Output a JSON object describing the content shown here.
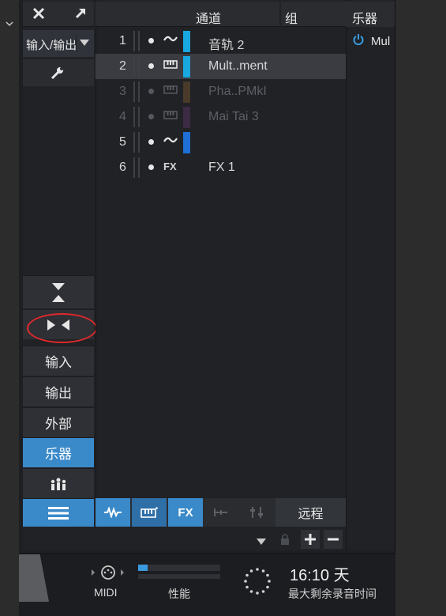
{
  "outer": {
    "chevron_icon": "chevron-down-icon"
  },
  "left_panel": {
    "io_dropdown": "输入/输出",
    "buttons": [
      "输入",
      "输出",
      "外部",
      "乐器"
    ],
    "active_button": "乐器"
  },
  "header": {
    "channel": "通道",
    "group": "组",
    "instrument": "乐器"
  },
  "tracks": [
    {
      "num": "1",
      "type": "audio",
      "color": "#18a7de",
      "name": "音轨 2",
      "selected": false,
      "dim": false
    },
    {
      "num": "2",
      "type": "instrument",
      "color": "#18a7de",
      "name": "Mult..ment",
      "selected": true,
      "dim": false
    },
    {
      "num": "3",
      "type": "instrument",
      "color": "#4a3a2a",
      "name": "Pha..PMkI",
      "selected": false,
      "dim": true
    },
    {
      "num": "4",
      "type": "instrument",
      "color": "#3d2a45",
      "name": "Mai Tai 3",
      "selected": false,
      "dim": true
    },
    {
      "num": "5",
      "type": "audio",
      "color": "#1e6fd6",
      "name": "",
      "selected": false,
      "dim": false
    },
    {
      "num": "6",
      "type": "fx",
      "type_label": "FX",
      "color": "",
      "name": "FX 1",
      "selected": false,
      "dim": false
    }
  ],
  "instrument_panel": {
    "item": "Mul",
    "power_icon": "power-icon"
  },
  "bottom_toolbar": {
    "fx": "FX",
    "remote": "远程"
  },
  "status": {
    "midi": "MIDI",
    "performance": "性能",
    "performance_level": 0.12,
    "time": "16:10 天",
    "remaining": "最大剩余录音时间"
  },
  "colors": {
    "accent": "#3a89c9",
    "annotation": "#e0292c"
  }
}
